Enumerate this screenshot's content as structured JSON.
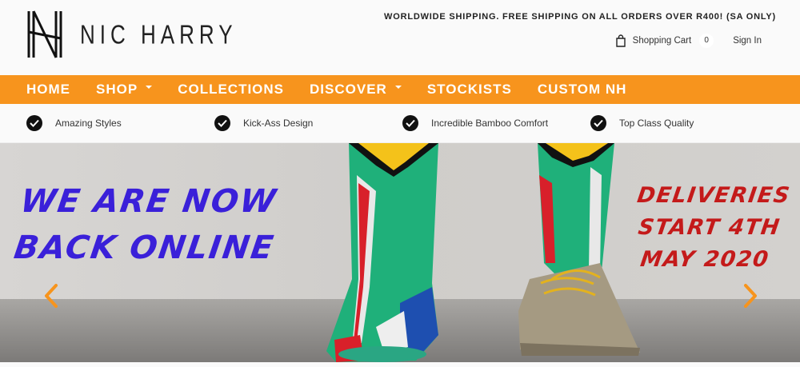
{
  "brand": {
    "name": "NIC HARRY"
  },
  "header": {
    "shipping_message": "WORLDWIDE SHIPPING. FREE SHIPPING ON ALL ORDERS OVER R400! (SA ONLY)",
    "cart_label": "Shopping Cart",
    "cart_count": "0",
    "signin_label": "Sign In"
  },
  "nav": {
    "items": [
      {
        "label": "HOME"
      },
      {
        "label": "SHOP"
      },
      {
        "label": "COLLECTIONS"
      },
      {
        "label": "DISCOVER"
      },
      {
        "label": "STOCKISTS"
      },
      {
        "label": "CUSTOM NH"
      }
    ]
  },
  "features": [
    {
      "label": "Amazing Styles",
      "icon": "check-circle-icon"
    },
    {
      "label": "Kick-Ass Design",
      "icon": "check-circle-icon"
    },
    {
      "label": "Incredible Bamboo Comfort",
      "icon": "check-circle-icon"
    },
    {
      "label": "Top Class Quality",
      "icon": "check-circle-icon"
    }
  ],
  "hero": {
    "left_line1": "WE ARE NOW",
    "left_line2": "BACK ONLINE",
    "right_line1": "DELIVERIES",
    "right_line2": "START 4TH",
    "right_line3": "MAY 2020"
  },
  "colors": {
    "nav_background": "#f7941d",
    "hero_left_text": "#3a20d9",
    "hero_right_text": "#c41a1a",
    "slider_arrows": "#f7941d"
  }
}
